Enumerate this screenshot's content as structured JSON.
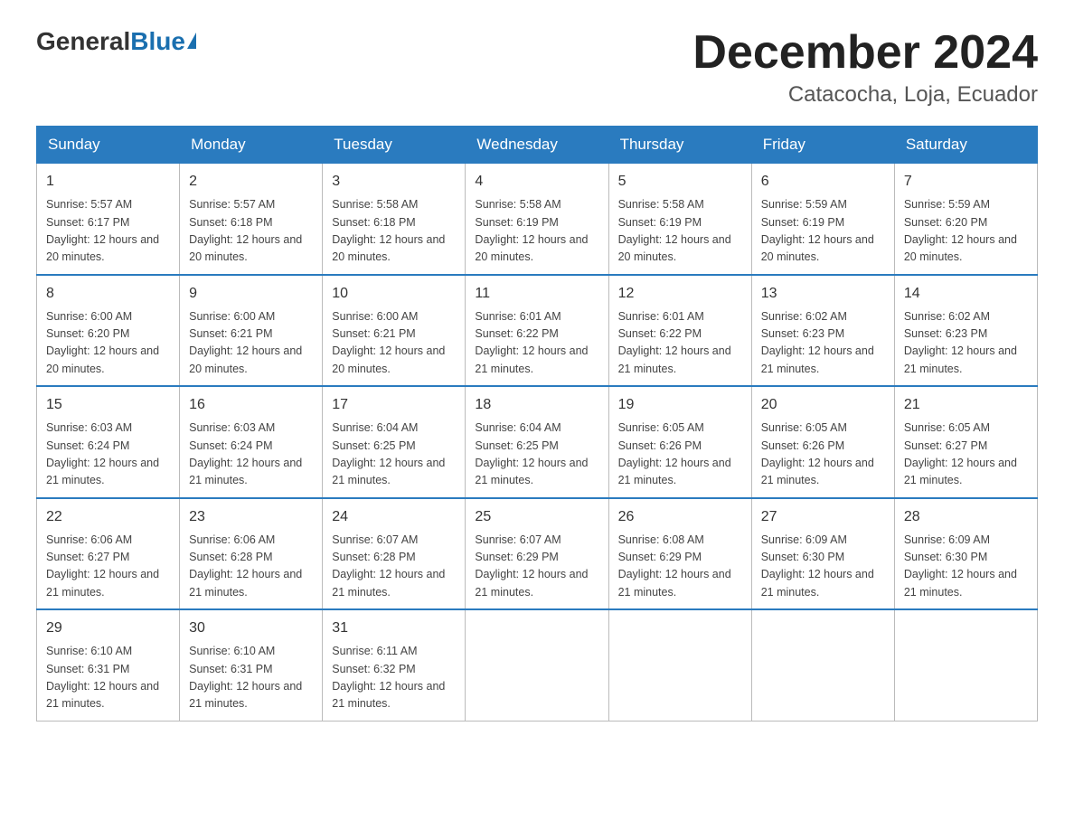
{
  "header": {
    "logo_general": "General",
    "logo_blue": "Blue",
    "month_title": "December 2024",
    "location": "Catacocha, Loja, Ecuador"
  },
  "days_of_week": [
    "Sunday",
    "Monday",
    "Tuesday",
    "Wednesday",
    "Thursday",
    "Friday",
    "Saturday"
  ],
  "weeks": [
    [
      {
        "day": "1",
        "sunrise": "5:57 AM",
        "sunset": "6:17 PM",
        "daylight": "12 hours and 20 minutes."
      },
      {
        "day": "2",
        "sunrise": "5:57 AM",
        "sunset": "6:18 PM",
        "daylight": "12 hours and 20 minutes."
      },
      {
        "day": "3",
        "sunrise": "5:58 AM",
        "sunset": "6:18 PM",
        "daylight": "12 hours and 20 minutes."
      },
      {
        "day": "4",
        "sunrise": "5:58 AM",
        "sunset": "6:19 PM",
        "daylight": "12 hours and 20 minutes."
      },
      {
        "day": "5",
        "sunrise": "5:58 AM",
        "sunset": "6:19 PM",
        "daylight": "12 hours and 20 minutes."
      },
      {
        "day": "6",
        "sunrise": "5:59 AM",
        "sunset": "6:19 PM",
        "daylight": "12 hours and 20 minutes."
      },
      {
        "day": "7",
        "sunrise": "5:59 AM",
        "sunset": "6:20 PM",
        "daylight": "12 hours and 20 minutes."
      }
    ],
    [
      {
        "day": "8",
        "sunrise": "6:00 AM",
        "sunset": "6:20 PM",
        "daylight": "12 hours and 20 minutes."
      },
      {
        "day": "9",
        "sunrise": "6:00 AM",
        "sunset": "6:21 PM",
        "daylight": "12 hours and 20 minutes."
      },
      {
        "day": "10",
        "sunrise": "6:00 AM",
        "sunset": "6:21 PM",
        "daylight": "12 hours and 20 minutes."
      },
      {
        "day": "11",
        "sunrise": "6:01 AM",
        "sunset": "6:22 PM",
        "daylight": "12 hours and 21 minutes."
      },
      {
        "day": "12",
        "sunrise": "6:01 AM",
        "sunset": "6:22 PM",
        "daylight": "12 hours and 21 minutes."
      },
      {
        "day": "13",
        "sunrise": "6:02 AM",
        "sunset": "6:23 PM",
        "daylight": "12 hours and 21 minutes."
      },
      {
        "day": "14",
        "sunrise": "6:02 AM",
        "sunset": "6:23 PM",
        "daylight": "12 hours and 21 minutes."
      }
    ],
    [
      {
        "day": "15",
        "sunrise": "6:03 AM",
        "sunset": "6:24 PM",
        "daylight": "12 hours and 21 minutes."
      },
      {
        "day": "16",
        "sunrise": "6:03 AM",
        "sunset": "6:24 PM",
        "daylight": "12 hours and 21 minutes."
      },
      {
        "day": "17",
        "sunrise": "6:04 AM",
        "sunset": "6:25 PM",
        "daylight": "12 hours and 21 minutes."
      },
      {
        "day": "18",
        "sunrise": "6:04 AM",
        "sunset": "6:25 PM",
        "daylight": "12 hours and 21 minutes."
      },
      {
        "day": "19",
        "sunrise": "6:05 AM",
        "sunset": "6:26 PM",
        "daylight": "12 hours and 21 minutes."
      },
      {
        "day": "20",
        "sunrise": "6:05 AM",
        "sunset": "6:26 PM",
        "daylight": "12 hours and 21 minutes."
      },
      {
        "day": "21",
        "sunrise": "6:05 AM",
        "sunset": "6:27 PM",
        "daylight": "12 hours and 21 minutes."
      }
    ],
    [
      {
        "day": "22",
        "sunrise": "6:06 AM",
        "sunset": "6:27 PM",
        "daylight": "12 hours and 21 minutes."
      },
      {
        "day": "23",
        "sunrise": "6:06 AM",
        "sunset": "6:28 PM",
        "daylight": "12 hours and 21 minutes."
      },
      {
        "day": "24",
        "sunrise": "6:07 AM",
        "sunset": "6:28 PM",
        "daylight": "12 hours and 21 minutes."
      },
      {
        "day": "25",
        "sunrise": "6:07 AM",
        "sunset": "6:29 PM",
        "daylight": "12 hours and 21 minutes."
      },
      {
        "day": "26",
        "sunrise": "6:08 AM",
        "sunset": "6:29 PM",
        "daylight": "12 hours and 21 minutes."
      },
      {
        "day": "27",
        "sunrise": "6:09 AM",
        "sunset": "6:30 PM",
        "daylight": "12 hours and 21 minutes."
      },
      {
        "day": "28",
        "sunrise": "6:09 AM",
        "sunset": "6:30 PM",
        "daylight": "12 hours and 21 minutes."
      }
    ],
    [
      {
        "day": "29",
        "sunrise": "6:10 AM",
        "sunset": "6:31 PM",
        "daylight": "12 hours and 21 minutes."
      },
      {
        "day": "30",
        "sunrise": "6:10 AM",
        "sunset": "6:31 PM",
        "daylight": "12 hours and 21 minutes."
      },
      {
        "day": "31",
        "sunrise": "6:11 AM",
        "sunset": "6:32 PM",
        "daylight": "12 hours and 21 minutes."
      },
      null,
      null,
      null,
      null
    ]
  ]
}
